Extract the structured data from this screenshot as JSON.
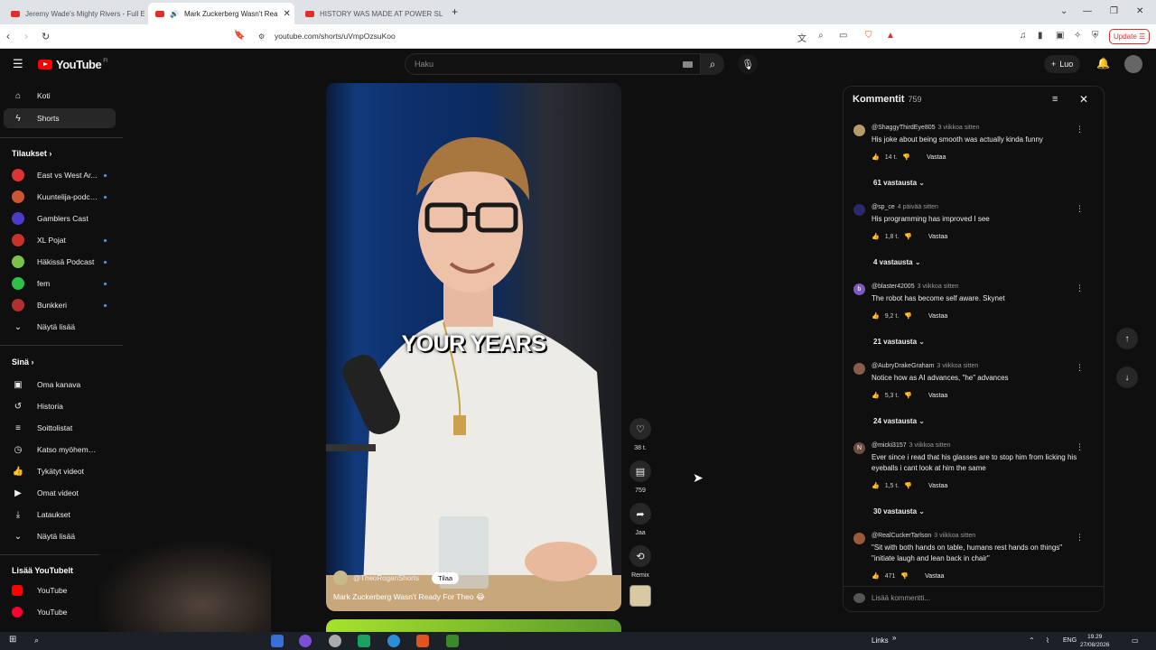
{
  "browser": {
    "tabs": [
      {
        "label": "Jeremy Wade's Mighty Rivers - Full E",
        "active": false
      },
      {
        "label": "Mark Zuckerberg Wasn't Rea",
        "active": true
      },
      {
        "label": "HISTORY WAS MADE AT POWER SLA",
        "active": false
      }
    ],
    "url": "youtube.com/shorts/uVmpOzsuKoo",
    "update_label": "Update"
  },
  "header": {
    "logo_text": "YouTube",
    "logo_region": "FI",
    "search_placeholder": "Haku",
    "create_label": "Luo"
  },
  "sidebar": {
    "main": [
      {
        "label": "Koti",
        "icon": "home-icon"
      },
      {
        "label": "Shorts",
        "icon": "shorts-icon",
        "active": true
      }
    ],
    "subscriptions_title": "Tilaukset",
    "subscriptions": [
      {
        "label": "East vs West Ar...",
        "color": "#d33",
        "live": true
      },
      {
        "label": "Kuuntelija-podca...",
        "color": "#c53",
        "live": true
      },
      {
        "label": "Gamblers Cast",
        "color": "#4a3cc8",
        "live": false
      },
      {
        "label": "XL Pojat",
        "color": "#c8322a",
        "live": true
      },
      {
        "label": "Häkissä Podcast",
        "color": "#7dc04a",
        "live": true
      },
      {
        "label": "fem",
        "color": "#2fbf4a",
        "live": true
      },
      {
        "label": "Bunkkeri",
        "color": "#b23030",
        "live": true
      }
    ],
    "show_more_1": "Näytä lisää",
    "you_title": "Sinä",
    "you_items": [
      {
        "label": "Oma kanava",
        "icon": "user-icon"
      },
      {
        "label": "Historia",
        "icon": "history-icon"
      },
      {
        "label": "Soittolistat",
        "icon": "playlist-icon"
      },
      {
        "label": "Katso myöhemmin",
        "icon": "clock-icon"
      },
      {
        "label": "Tykätyt videot",
        "icon": "thumb-up-icon"
      },
      {
        "label": "Omat videot",
        "icon": "video-icon"
      },
      {
        "label": "Lataukset",
        "icon": "download-icon"
      },
      {
        "label": "Näytä lisää",
        "icon": "chevron-down-icon"
      }
    ],
    "more_title": "Lisää YouTubelt",
    "more_items": [
      {
        "label": "YouTube",
        "color": "#ff0000"
      },
      {
        "label": "YouTube",
        "color": "#ff0033"
      }
    ]
  },
  "short": {
    "caption": "YOUR YEARS",
    "channel": "@TheoRoganShorts",
    "subscribe_label": "Tilaa",
    "title": "Mark Zuckerberg Wasn't Ready For Theo 😂",
    "likes": "38 t.",
    "comments": "759",
    "share": "Jaa",
    "remix": "Remix"
  },
  "comments_panel": {
    "title": "Kommentit",
    "count": "759",
    "add_placeholder": "Lisää kommentti...",
    "reply_label": "Vastaa",
    "items": [
      {
        "author": "@ShaggyThirdEye805",
        "time": "3 viikkoa sitten",
        "text": "His joke about being smooth was actually kinda funny",
        "likes": "14 t.",
        "replies": "61 vastausta",
        "avatar_color": "#b89a6a",
        "avatar_letter": ""
      },
      {
        "author": "@sp_ce",
        "time": "4 päivää sitten",
        "text": "His programming has improved I see",
        "likes": "1,8 t.",
        "replies": "4 vastausta",
        "avatar_color": "#2a2a6a",
        "avatar_letter": ""
      },
      {
        "author": "@blaster42005",
        "time": "3 viikkoa sitten",
        "text": "The robot has become self aware. Skynet",
        "likes": "9,2 t.",
        "replies": "21 vastausta",
        "avatar_color": "#7e57c2",
        "avatar_letter": "b"
      },
      {
        "author": "@AubryDrakeGraham",
        "time": "3 viikkoa sitten",
        "text": "Notice how as AI advances, \"he\" advances",
        "likes": "5,3 t.",
        "replies": "24 vastausta",
        "avatar_color": "#8a5a4a",
        "avatar_letter": ""
      },
      {
        "author": "@micki3157",
        "time": "3 viikkoa sitten",
        "text": "Ever since i read that his glasses are to stop him from licking his eyeballs i cant look at him the same",
        "likes": "1,5 t.",
        "replies": "30 vastausta",
        "avatar_color": "#6d4c41",
        "avatar_letter": "N"
      },
      {
        "author": "@RealCuckerTarlson",
        "time": "3 viikkoa sitten",
        "text": "\"Sit with both hands on table, humans rest hands on things\" \"initiate laugh and lean back in chair\"",
        "likes": "471",
        "replies": "",
        "avatar_color": "#9a5a3a",
        "avatar_letter": ""
      }
    ]
  },
  "taskbar": {
    "links_label": "Links",
    "lang": "ENG",
    "time": "19.29",
    "date": "27/08/2026"
  }
}
